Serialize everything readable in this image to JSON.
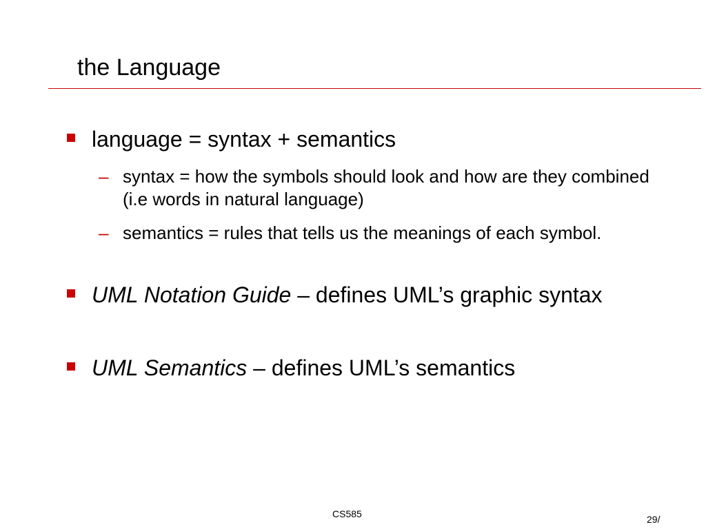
{
  "slide": {
    "title": "the Language",
    "bullets": [
      {
        "text": "language = syntax + semantics",
        "subs": [
          {
            "text": "syntax = how the symbols should look and how are they combined (i.e words in natural language)"
          },
          {
            "text": "semantics = rules that tells us the meanings of each symbol."
          }
        ]
      },
      {
        "italic": "UML Notation Guide",
        "rest": " – defines UML’s graphic syntax"
      },
      {
        "italic": "UML Semantics",
        "rest": " – defines UML’s semantics"
      }
    ],
    "sub_marker": "–"
  },
  "footer": {
    "course": "CS585",
    "page": "29/"
  },
  "colors": {
    "accent": "#cc0000",
    "text": "#000000",
    "background": "#ffffff"
  }
}
